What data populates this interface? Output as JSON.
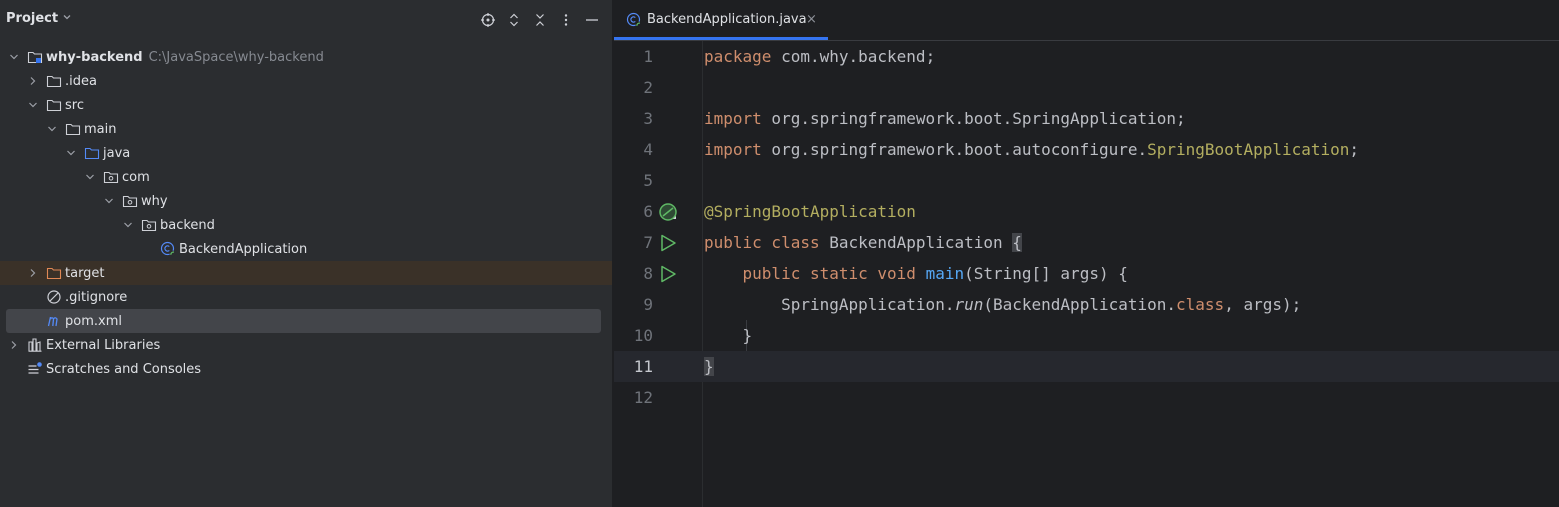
{
  "project_panel": {
    "title": "Project",
    "toolbar_icons": [
      "locate-icon",
      "expand-collapse-icon",
      "close-all-icon",
      "more-icon",
      "minimize-icon"
    ],
    "tree": [
      {
        "label": "why-backend",
        "path": "C:\\JavaSpace\\why-backend",
        "bold": true,
        "depth": 0,
        "expanded": true,
        "icon": "module-folder-icon"
      },
      {
        "label": ".idea",
        "depth": 1,
        "expanded": false,
        "icon": "folder-icon"
      },
      {
        "label": "src",
        "depth": 1,
        "expanded": true,
        "icon": "folder-icon"
      },
      {
        "label": "main",
        "depth": 2,
        "expanded": true,
        "icon": "folder-icon"
      },
      {
        "label": "java",
        "depth": 3,
        "expanded": true,
        "icon": "source-folder-icon"
      },
      {
        "label": "com",
        "depth": 4,
        "expanded": true,
        "icon": "package-icon"
      },
      {
        "label": "why",
        "depth": 5,
        "expanded": true,
        "icon": "package-icon"
      },
      {
        "label": "backend",
        "depth": 6,
        "expanded": true,
        "icon": "package-icon"
      },
      {
        "label": "BackendApplication",
        "depth": 7,
        "icon": "spring-class-icon"
      },
      {
        "label": "target",
        "depth": 1,
        "expanded": false,
        "icon": "excluded-folder-icon"
      },
      {
        "label": ".gitignore",
        "depth": 1,
        "icon": "gitignore-icon"
      },
      {
        "label": "pom.xml",
        "depth": 1,
        "icon": "maven-icon"
      },
      {
        "label": "External Libraries",
        "depth": 0,
        "expanded": false,
        "icon": "libraries-icon"
      },
      {
        "label": "Scratches and Consoles",
        "depth": 0,
        "icon": "scratches-icon"
      }
    ]
  },
  "editor": {
    "tab": {
      "label": "BackendApplication.java",
      "close": "×"
    },
    "lines": [
      {
        "num": "1"
      },
      {
        "num": "2"
      },
      {
        "num": "3"
      },
      {
        "num": "4"
      },
      {
        "num": "5"
      },
      {
        "num": "6"
      },
      {
        "num": "7"
      },
      {
        "num": "8"
      },
      {
        "num": "9"
      },
      {
        "num": "10"
      },
      {
        "num": "11"
      },
      {
        "num": "12"
      }
    ],
    "code": {
      "l1_kw": "package",
      "l1_rest": " com.why.backend;",
      "l3_kw": "import",
      "l3_rest": " org.springframework.boot.SpringApplication;",
      "l4_kw": "import",
      "l4_mid": " org.springframework.boot.autoconfigure.",
      "l4_ann": "SpringBootApplication",
      "l4_end": ";",
      "l6_ann": "@SpringBootApplication",
      "l7_kw": "public class",
      "l7_rest": " BackendApplication ",
      "l7_brace": "{",
      "l8_indent": "    ",
      "l8_kw": "public static void",
      "l8_sp": " ",
      "l8_fn": "main",
      "l8_rest": "(String[] args) {",
      "l9_indent": "        ",
      "l9_cls": "SpringApplication.",
      "l9_run": "run",
      "l9_mid": "(BackendApplication.",
      "l9_kw": "class",
      "l9_end": ", args);",
      "l10": "    }",
      "l11": "}"
    }
  },
  "colors": {
    "keyword": "#cf8e6d",
    "annotation": "#b3ae60",
    "function": "#56a8f5",
    "text": "#bcbec4",
    "accent": "#3574f0",
    "run_green": "#5fb865"
  }
}
